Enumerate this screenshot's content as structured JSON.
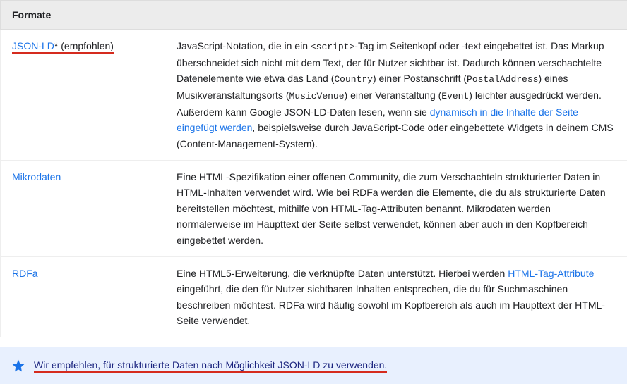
{
  "table": {
    "header": "Formate",
    "rows": [
      {
        "name_link": "JSON-LD",
        "name_extra": "* (empfohlen)",
        "desc_a": "JavaScript-Notation, die in ein ",
        "code1": "<script>",
        "desc_b": "-Tag im Seitenkopf oder -text eingebettet ist. Das Markup überschneidet sich nicht mit dem Text, der für Nutzer sichtbar ist. Dadurch können verschachtelte Datenelemente wie etwa das Land (",
        "code2": "Country",
        "desc_c": ") einer Postanschrift (",
        "code3": "PostalAddress",
        "desc_d": ") eines Musikveranstaltungsorts (",
        "code4": "MusicVenue",
        "desc_e": ") einer Veranstaltung (",
        "code5": "Event",
        "desc_f": ") leichter ausgedrückt werden. Außerdem kann Google JSON-LD-Daten lesen, wenn sie ",
        "link_text": "dynamisch in die Inhalte der Seite eingefügt werden",
        "desc_g": ", beispielsweise durch JavaScript-Code oder eingebettete Widgets in deinem CMS (Content-Management-System)."
      },
      {
        "name_link": "Mikrodaten",
        "desc": "Eine HTML-Spezifikation einer offenen Community, die zum Verschachteln strukturierter Daten in HTML-Inhalten verwendet wird. Wie bei RDFa werden die Elemente, die du als strukturierte Daten bereitstellen möchtest, mithilfe von HTML-Tag-Attributen benannt. Mikrodaten werden normalerweise im Haupttext der Seite selbst verwendet, können aber auch in den Kopfbereich eingebettet werden."
      },
      {
        "name_link": "RDFa",
        "desc_a": "Eine HTML5-Erweiterung, die verknüpfte Daten unterstützt. Hierbei werden ",
        "link_text": "HTML-Tag-Attribute",
        "desc_b": " eingeführt, die den für Nutzer sichtbaren Inhalten entsprechen, die du für Suchmaschinen beschreiben möchtest. RDFa wird häufig sowohl im Kopfbereich als auch im Haupttext der HTML-Seite verwendet."
      }
    ]
  },
  "callout": {
    "text": "Wir empfehlen, für strukturierte Daten nach Möglichkeit JSON-LD zu verwenden."
  }
}
